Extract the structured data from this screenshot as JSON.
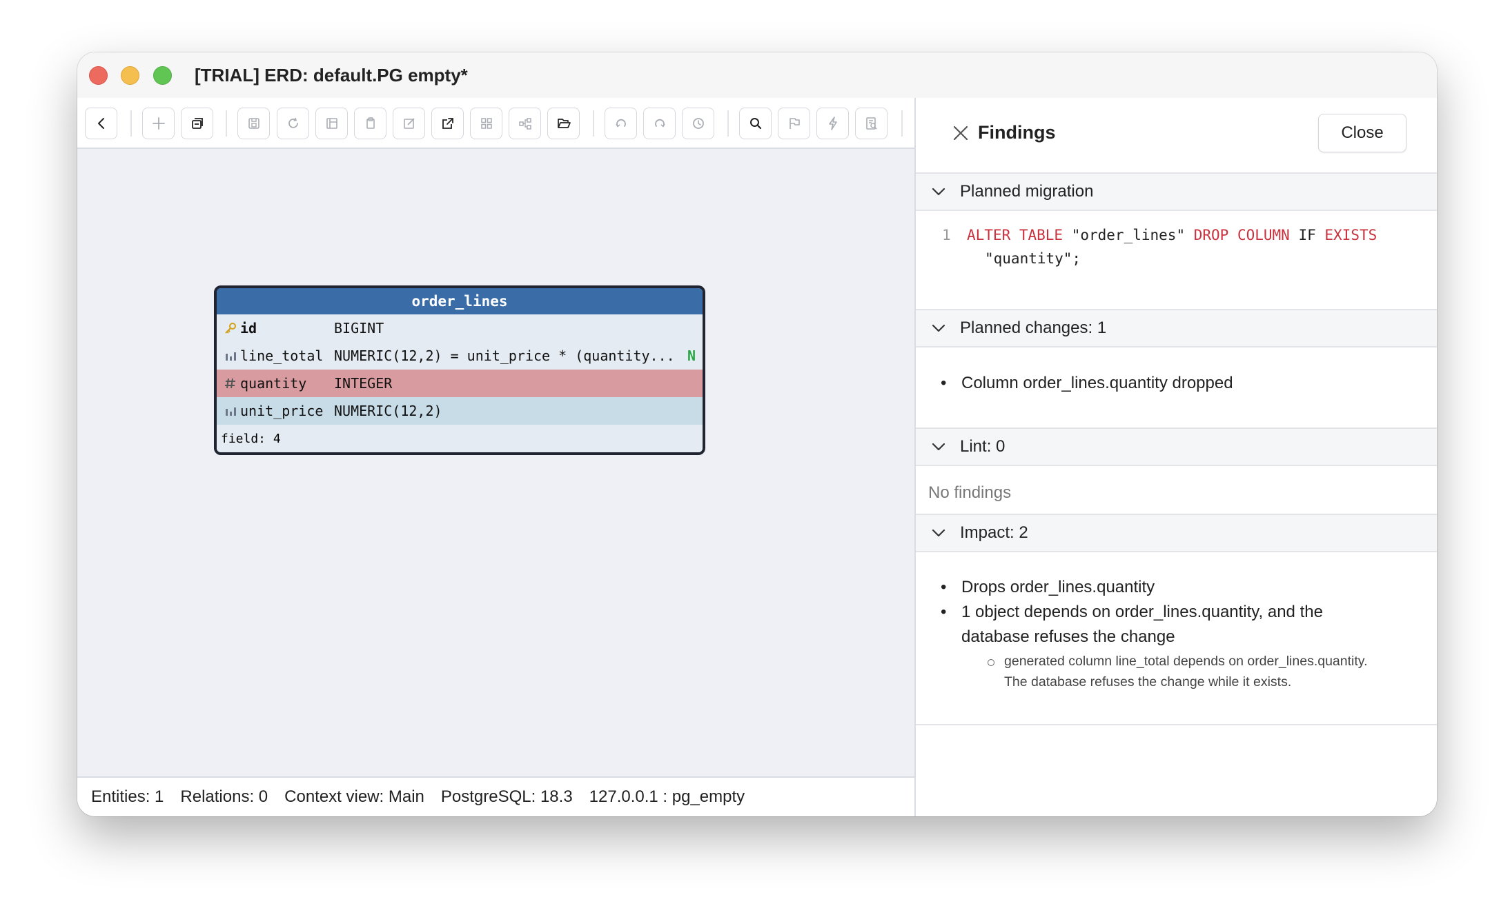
{
  "window": {
    "title": "[TRIAL] ERD: default.PG empty*"
  },
  "toolbar": {
    "buttons": [
      {
        "name": "back",
        "icon": "chevron-left-icon",
        "enabled": true
      },
      {
        "name": "add",
        "icon": "plus-icon",
        "enabled": false
      },
      {
        "name": "copy-window",
        "icon": "stack-icon",
        "enabled": true
      },
      {
        "name": "save",
        "icon": "save-icon",
        "enabled": false
      },
      {
        "name": "refresh",
        "icon": "refresh-icon",
        "enabled": false
      },
      {
        "name": "layout",
        "icon": "layout-icon",
        "enabled": false
      },
      {
        "name": "clipboard",
        "icon": "clipboard-icon",
        "enabled": false
      },
      {
        "name": "edit",
        "icon": "edit-icon",
        "enabled": false
      },
      {
        "name": "export",
        "icon": "export-icon",
        "enabled": true
      },
      {
        "name": "grid",
        "icon": "grid-icon",
        "enabled": false
      },
      {
        "name": "diagram",
        "icon": "diagram-icon",
        "enabled": false
      },
      {
        "name": "open",
        "icon": "folder-open-icon",
        "enabled": true
      },
      {
        "name": "undo",
        "icon": "undo-icon",
        "enabled": false
      },
      {
        "name": "redo",
        "icon": "redo-icon",
        "enabled": false
      },
      {
        "name": "history",
        "icon": "history-icon",
        "enabled": false
      },
      {
        "name": "search",
        "icon": "search-icon",
        "enabled": true
      },
      {
        "name": "flag",
        "icon": "flag-icon",
        "enabled": false
      },
      {
        "name": "run",
        "icon": "lightning-icon",
        "enabled": false
      },
      {
        "name": "inspect",
        "icon": "inspect-icon",
        "enabled": false
      }
    ]
  },
  "entity": {
    "name": "order_lines",
    "columns": [
      {
        "name": "id",
        "type": "BIGINT",
        "icon": "key-icon",
        "state": "key",
        "flag": ""
      },
      {
        "name": "line_total",
        "type": "NUMERIC(12,2) = unit_price * (quantity...",
        "icon": "column-icon",
        "state": "generated",
        "flag": "N"
      },
      {
        "name": "quantity",
        "type": "INTEGER",
        "icon": "hash-icon",
        "state": "dropped",
        "flag": ""
      },
      {
        "name": "unit_price",
        "type": "NUMERIC(12,2)",
        "icon": "column-icon",
        "state": "plain",
        "flag": ""
      }
    ],
    "footer": "field: 4"
  },
  "statusbar": {
    "entities": "Entities: 1",
    "relations": "Relations: 0",
    "context": "Context view: Main",
    "db": "PostgreSQL: 18.3",
    "connection": "127.0.0.1 : pg_empty"
  },
  "findings": {
    "title": "Findings",
    "close_label": "Close",
    "migration": {
      "header": "Planned migration",
      "line_number": "1",
      "line1": [
        {
          "t": "ALTER TABLE",
          "kw": true
        },
        {
          "t": " \"order_lines\" ",
          "kw": false
        },
        {
          "t": "DROP COLUMN",
          "kw": true
        },
        {
          "t": " IF ",
          "kw": false
        },
        {
          "t": "EXISTS",
          "kw": true
        }
      ],
      "line2": "\"quantity\";"
    },
    "changes": {
      "header": "Planned changes: 1",
      "items": [
        "Column order_lines.quantity dropped"
      ]
    },
    "lint": {
      "header": "Lint: 0",
      "empty_text": "No findings"
    },
    "impact": {
      "header": "Impact: 2",
      "item1": "Drops order_lines.quantity",
      "item2_line1": "1 object depends on order_lines.quantity, and the",
      "item2_line2": "database refuses the change",
      "sub_line1": "generated column line_total depends on order_lines.quantity.",
      "sub_line2": "The database refuses the change while it exists."
    }
  },
  "colors": {
    "entity_header": "#3a6da7",
    "dropped_row": "#d89b9f",
    "keyword": "#c8313d",
    "nullable_flag": "#27a845"
  }
}
